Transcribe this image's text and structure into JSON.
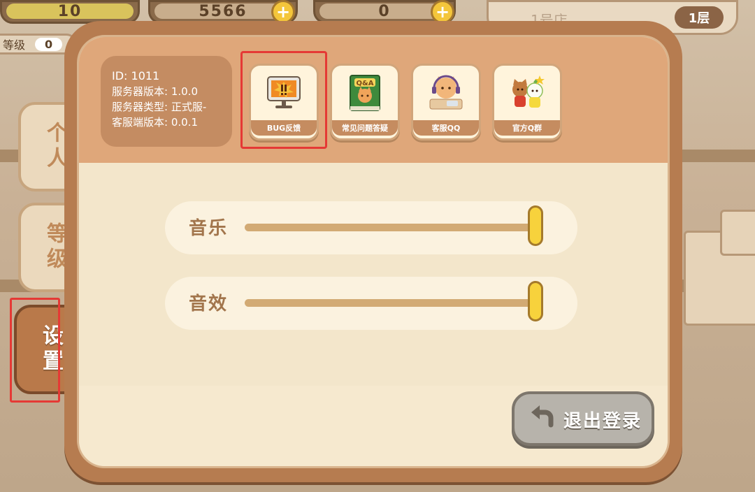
{
  "topbar": {
    "level_value": "10",
    "fish_count": "5566",
    "gem_count": "0",
    "level_label": "等级",
    "level_small_value": "0",
    "store_name": "1号店",
    "floor_label": "1层"
  },
  "side_tabs": [
    {
      "label": "个人",
      "active": false
    },
    {
      "label": "等级",
      "active": false
    },
    {
      "label": "设置",
      "active": true
    }
  ],
  "info": {
    "id": "ID: 1011",
    "server_version": "服务器版本:  1.0.0",
    "server_type": "服务器类型:  正式服-",
    "client_version": "客服端版本:  0.0.1"
  },
  "buttons": [
    {
      "label": "BUG反馈",
      "icon": "bug-report-monitor-icon"
    },
    {
      "label": "常见问题答疑",
      "icon": "qa-book-icon"
    },
    {
      "label": "客服QQ",
      "icon": "customer-service-cat-icon"
    },
    {
      "label": "官方Q群",
      "icon": "official-group-cats-icon"
    }
  ],
  "settings": {
    "music_label": "音乐",
    "music_level": 1.0,
    "sfx_label": "音效",
    "sfx_level": 1.0
  },
  "logout": {
    "label": "退出登录"
  },
  "colors": {
    "highlight": "#e53935",
    "dialog_border": "#b67c50",
    "slider_handle": "#f7d23c",
    "active_tab": "#b9794a"
  }
}
